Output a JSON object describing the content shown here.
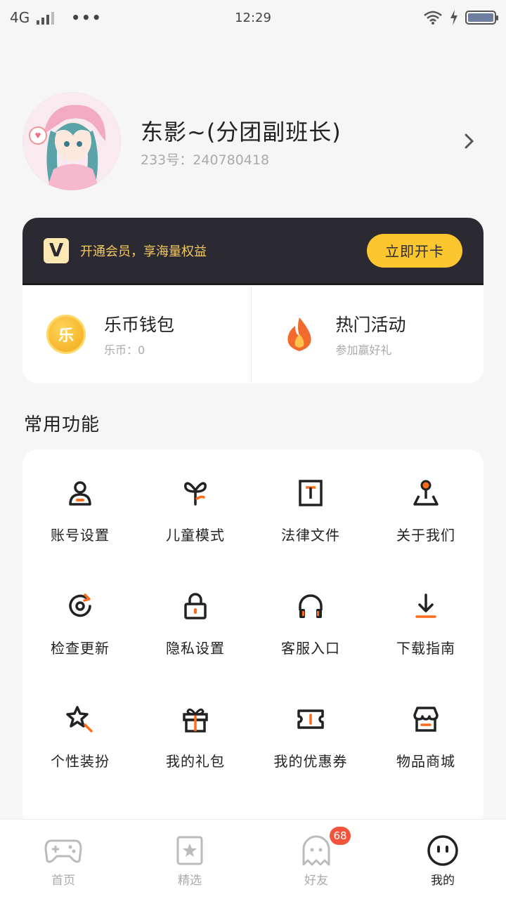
{
  "status_bar": {
    "network": "4G",
    "time": "12:29"
  },
  "profile": {
    "nickname": "东影~(分团副班长)",
    "uid": "233号：240780418"
  },
  "vip": {
    "logo": "V",
    "promo_text": "开通会员，享海量权益",
    "button_label": "立即开卡"
  },
  "wallet": {
    "title": "乐币钱包",
    "coin_glyph": "乐",
    "subtitle": "乐币：0"
  },
  "activity": {
    "title": "热门活动",
    "subtitle": "参加赢好礼"
  },
  "section_title": "常用功能",
  "functions": [
    {
      "label": "账号设置",
      "icon": "account-icon"
    },
    {
      "label": "儿童模式",
      "icon": "sprout-icon"
    },
    {
      "label": "法律文件",
      "icon": "document-icon"
    },
    {
      "label": "关于我们",
      "icon": "location-pin-icon"
    },
    {
      "label": "检查更新",
      "icon": "refresh-icon"
    },
    {
      "label": "隐私设置",
      "icon": "lock-icon"
    },
    {
      "label": "客服入口",
      "icon": "headphones-icon"
    },
    {
      "label": "下载指南",
      "icon": "download-icon"
    },
    {
      "label": "个性装扮",
      "icon": "star-wand-icon"
    },
    {
      "label": "我的礼包",
      "icon": "gift-icon"
    },
    {
      "label": "我的优惠券",
      "icon": "ticket-icon"
    },
    {
      "label": "物品商城",
      "icon": "shop-icon"
    }
  ],
  "nav": [
    {
      "label": "首页",
      "icon": "gamepad-icon"
    },
    {
      "label": "精选",
      "icon": "star-card-icon"
    },
    {
      "label": "好友",
      "icon": "ghost-icon",
      "badge": "68"
    },
    {
      "label": "我的",
      "icon": "face-icon",
      "active": true
    }
  ],
  "colors": {
    "accent": "#ff6a1a",
    "vip_gold": "#fcc62f",
    "vip_dark": "#2b2a33"
  }
}
